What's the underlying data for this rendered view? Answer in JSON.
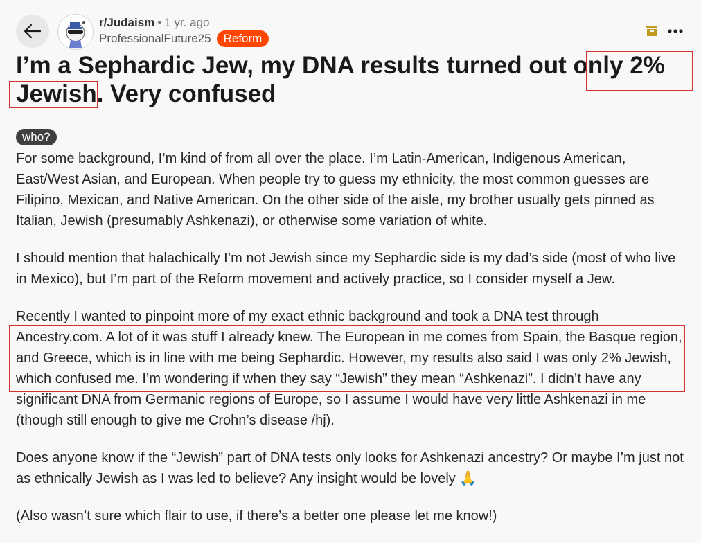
{
  "header": {
    "subreddit": "r/Judaism",
    "separator": "•",
    "time": "1 yr. ago",
    "author": "ProfessionalFuture25",
    "flair": "Reform"
  },
  "post": {
    "title_part1": "I’m a Sephardic Jew, my DNA results turned out ",
    "title_highlight_a": "only 2%",
    "title_space": " ",
    "title_highlight_b": "Jewish",
    "title_part2": ". Very confused",
    "flair_badge": "who?",
    "paragraphs": [
      "For some background, I’m kind of from all over the place. I’m Latin-American, Indigenous American, East/West Asian, and European. When people try to guess my ethnicity, the most common guesses are Filipino, Mexican, and Native American. On the other side of the aisle, my brother usually gets pinned as Italian, Jewish (presumably Ashkenazi), or otherwise some variation of white.",
      "I should mention that halachically I’m not Jewish since my Sephardic side is my dad’s side (most of who live in Mexico), but I’m part of the Reform movement and actively practice, so I consider myself a Jew.",
      "Recently I wanted to pinpoint more of my exact ethnic background and took a DNA test through Ancestry.com. A lot of it was stuff I already knew. The European in me comes from Spain, the Basque region, and Greece, which is in line with me being Sephardic. However, my results also said I was only 2% Jewish, which confused me. I’m wondering if when they say “Jewish” they mean “Ashkenazi”. I didn’t have any significant DNA from Germanic regions of Europe, so I assume I would have very little Ashkenazi in me (though still enough to give me Crohn’s disease /hj).",
      "Does anyone know if the “Jewish” part of DNA tests only looks for Ashkenazi ancestry? Or maybe I’m just not as ethnically Jewish as I was led to believe? Any insight would be lovely 🙏",
      "(Also wasn’t sure which flair to use, if there’s a better one please let me know!)"
    ]
  },
  "icons": {
    "back": "arrow-left-icon",
    "archive": "archive-box-icon",
    "more": "more-horizontal-icon",
    "avatar": "snoo-avatar-icon"
  },
  "colors": {
    "flair": "#ff4500",
    "highlight_box": "#d32f2f",
    "archive_icon": "#c49a1e"
  }
}
